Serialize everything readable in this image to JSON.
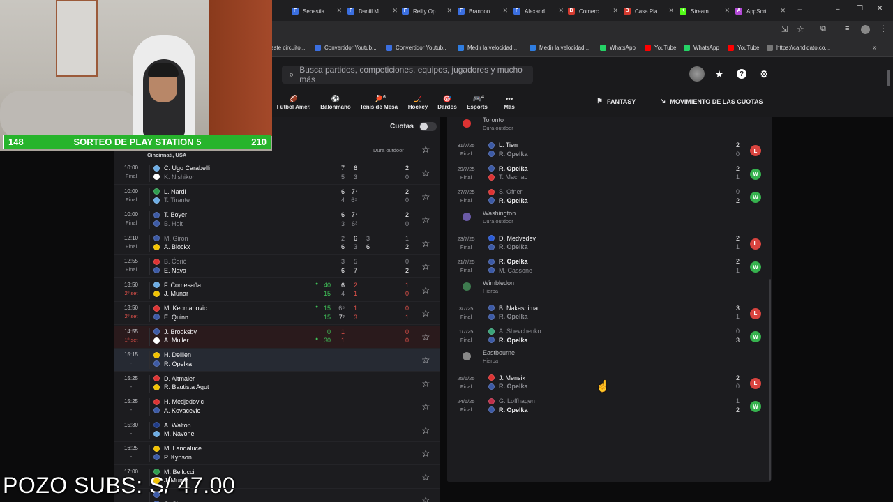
{
  "browser": {
    "tabs": [
      {
        "label": "este circuito",
        "fav": "",
        "color": "#555"
      },
      {
        "label": "Sebastia",
        "fav": "F",
        "color": "#3b6fe0"
      },
      {
        "label": "Daniil M",
        "fav": "F",
        "color": "#3b6fe0"
      },
      {
        "label": "Reilly Op",
        "fav": "F",
        "color": "#3b6fe0"
      },
      {
        "label": "Brandon",
        "fav": "F",
        "color": "#3b6fe0"
      },
      {
        "label": "Alexand",
        "fav": "F",
        "color": "#3b6fe0"
      },
      {
        "label": "Comerc",
        "fav": "B",
        "color": "#d43a2f"
      },
      {
        "label": "Casa Pla",
        "fav": "B",
        "color": "#d43a2f"
      },
      {
        "label": "Stream",
        "fav": "K",
        "color": "#53fc18"
      },
      {
        "label": "AppSort",
        "fav": "A",
        "color": "#b44ad8"
      }
    ],
    "bookmarks": [
      {
        "label": "este circuito...",
        "color": "#888"
      },
      {
        "label": "Convertidor Youtub...",
        "color": "#3b6fe0"
      },
      {
        "label": "Convertidor Youtub...",
        "color": "#3b6fe0"
      },
      {
        "label": "Medir la velocidad...",
        "color": "#2f7de1"
      },
      {
        "label": "Medir la velocidad...",
        "color": "#2f7de1"
      },
      {
        "label": "WhatsApp",
        "color": "#25d366"
      },
      {
        "label": "YouTube",
        "color": "#ff0000"
      },
      {
        "label": "WhatsApp",
        "color": "#25d366"
      },
      {
        "label": "YouTube",
        "color": "#ff0000"
      },
      {
        "label": "https://candidato.co...",
        "color": "#777"
      }
    ]
  },
  "header": {
    "search_placeholder": "Busca partidos, competiciones, equipos, jugadores y mucho más",
    "sports": [
      {
        "label": "Fútbol Amer.",
        "icon": "football-icon",
        "glyph": "🏈",
        "count": ""
      },
      {
        "label": "Balonmano",
        "icon": "handball-icon",
        "glyph": "⚽",
        "count": ""
      },
      {
        "label": "Tenis de Mesa",
        "icon": "table-tennis-icon",
        "glyph": "🏓",
        "count": "6"
      },
      {
        "label": "Hockey",
        "icon": "hockey-icon",
        "glyph": "🏒",
        "count": ""
      },
      {
        "label": "Dardos",
        "icon": "darts-icon",
        "glyph": "🎯",
        "count": ""
      },
      {
        "label": "Esports",
        "icon": "esports-icon",
        "glyph": "🎮",
        "count": "4"
      },
      {
        "label": "Más",
        "icon": "more-icon",
        "glyph": "•••",
        "count": ""
      }
    ],
    "fantasy": "FANTASY",
    "odds_movement": "MOVIMIENTO DE LAS CUOTAS"
  },
  "left": {
    "odds_label": "Cuotas",
    "tournament_place": "Cincinnati, USA",
    "surface": "Dura outdoor",
    "matches": [
      {
        "time": "10:00",
        "status": "Final",
        "live": false,
        "p1": {
          "name": "C. Ugo Carabelli",
          "flag": "#6cace4",
          "win": true
        },
        "p2": {
          "name": "K. Nishikori",
          "flag": "#ffffff",
          "win": false
        },
        "s1": [
          "7",
          "6"
        ],
        "s2": [
          "5",
          "3"
        ],
        "sets": [
          "2",
          "0"
        ],
        "pts": [
          "",
          ""
        ]
      },
      {
        "time": "10:00",
        "status": "Final",
        "live": false,
        "p1": {
          "name": "L. Nardi",
          "flag": "#2e9e4f",
          "win": true
        },
        "p2": {
          "name": "T. Tirante",
          "flag": "#6cace4",
          "win": false
        },
        "s1": [
          "6",
          "7⁷"
        ],
        "s2": [
          "4",
          "6⁵"
        ],
        "sets": [
          "2",
          "0"
        ],
        "pts": [
          "",
          ""
        ]
      },
      {
        "time": "10:00",
        "status": "Final",
        "live": false,
        "p1": {
          "name": "T. Boyer",
          "flag": "#3c5aa6",
          "win": true
        },
        "p2": {
          "name": "B. Holt",
          "flag": "#3c5aa6",
          "win": false
        },
        "s1": [
          "6",
          "7⁷"
        ],
        "s2": [
          "3",
          "6³"
        ],
        "sets": [
          "2",
          "0"
        ],
        "pts": [
          "",
          ""
        ]
      },
      {
        "time": "12:10",
        "status": "Final",
        "live": false,
        "p1": {
          "name": "M. Giron",
          "flag": "#3c5aa6",
          "win": false
        },
        "p2": {
          "name": "A. Blockx",
          "flag": "#f2c200",
          "win": true
        },
        "s1": [
          "2",
          "6",
          "3"
        ],
        "s2": [
          "6",
          "3",
          "6"
        ],
        "sets": [
          "1",
          "2"
        ],
        "pts": [
          "",
          ""
        ]
      },
      {
        "time": "12:55",
        "status": "Final",
        "live": false,
        "p1": {
          "name": "B. Ćorić",
          "flag": "#d33",
          "win": false
        },
        "p2": {
          "name": "E. Nava",
          "flag": "#3c5aa6",
          "win": true
        },
        "s1": [
          "3",
          "5"
        ],
        "s2": [
          "6",
          "7"
        ],
        "sets": [
          "0",
          "2"
        ],
        "pts": [
          "",
          ""
        ]
      },
      {
        "time": "13:50",
        "status": "2º set",
        "live": true,
        "p1": {
          "name": "F. Comesaña",
          "flag": "#6cace4",
          "win": true
        },
        "p2": {
          "name": "J. Munar",
          "flag": "#f2c200",
          "win": true
        },
        "s1": [
          "6",
          "2"
        ],
        "s2": [
          "4",
          "1"
        ],
        "sets": [
          "1",
          "0"
        ],
        "pts": [
          "40",
          "15"
        ],
        "serve": 1
      },
      {
        "time": "13:50",
        "status": "2º set",
        "live": true,
        "p1": {
          "name": "M. Kecmanovic",
          "flag": "#d33",
          "win": true
        },
        "p2": {
          "name": "E. Quinn",
          "flag": "#3c5aa6",
          "win": true
        },
        "s1": [
          "6⁵",
          "1"
        ],
        "s2": [
          "7⁷",
          "3"
        ],
        "sets": [
          "0",
          "1"
        ],
        "pts": [
          "15",
          "15"
        ],
        "serve": 1
      },
      {
        "time": "14:55",
        "status": "1º set",
        "live": true,
        "p1": {
          "name": "J. Brooksby",
          "flag": "#3c5aa6",
          "win": true
        },
        "p2": {
          "name": "A. Muller",
          "flag": "#ffffff",
          "win": true
        },
        "s1": [
          "1"
        ],
        "s2": [
          "1"
        ],
        "sets": [
          "0",
          "0"
        ],
        "pts": [
          "0",
          "30"
        ],
        "serve": 2
      },
      {
        "time": "15:15",
        "status": "-",
        "live": false,
        "p1": {
          "name": "H. Dellien",
          "flag": "#f2c200",
          "win": true
        },
        "p2": {
          "name": "R. Opelka",
          "flag": "#3c5aa6",
          "win": true
        },
        "s1": [],
        "s2": [],
        "sets": [
          "",
          ""
        ],
        "pts": [
          "",
          ""
        ]
      },
      {
        "time": "15:25",
        "status": "-",
        "live": false,
        "p1": {
          "name": "D. Altmaier",
          "flag": "#d33",
          "win": true
        },
        "p2": {
          "name": "R. Bautista Agut",
          "flag": "#f2c200",
          "win": true
        },
        "s1": [],
        "s2": [],
        "sets": [
          "",
          ""
        ],
        "pts": [
          "",
          ""
        ]
      },
      {
        "time": "15:25",
        "status": "-",
        "live": false,
        "p1": {
          "name": "H. Medjedovic",
          "flag": "#d33",
          "win": true
        },
        "p2": {
          "name": "A. Kovacevic",
          "flag": "#3c5aa6",
          "win": true
        },
        "s1": [],
        "s2": [],
        "sets": [
          "",
          ""
        ],
        "pts": [
          "",
          ""
        ]
      },
      {
        "time": "15:30",
        "status": "-",
        "live": false,
        "p1": {
          "name": "A. Walton",
          "flag": "#1f3c8a",
          "win": true
        },
        "p2": {
          "name": "M. Navone",
          "flag": "#6cace4",
          "win": true
        },
        "s1": [],
        "s2": [],
        "sets": [
          "",
          ""
        ],
        "pts": [
          "",
          ""
        ]
      },
      {
        "time": "16:25",
        "status": "-",
        "live": false,
        "p1": {
          "name": "M. Landaluce",
          "flag": "#f2c200",
          "win": true
        },
        "p2": {
          "name": "P. Kypson",
          "flag": "#3c5aa6",
          "win": true
        },
        "s1": [],
        "s2": [],
        "sets": [
          "",
          ""
        ],
        "pts": [
          "",
          ""
        ]
      },
      {
        "time": "17:00",
        "status": "-",
        "live": false,
        "p1": {
          "name": "M. Bellucci",
          "flag": "#2e9e4f",
          "win": true
        },
        "p2": {
          "name": "J. Munar",
          "flag": "#f2c200",
          "win": true
        },
        "s1": [],
        "s2": [],
        "sets": [
          "",
          ""
        ],
        "pts": [
          "",
          ""
        ]
      },
      {
        "time": "",
        "status": "-",
        "live": false,
        "p1": {
          "name": "",
          "flag": "#3c5aa6",
          "win": true
        },
        "p2": {
          "name": "C. Ciner",
          "flag": "#3c5aa6",
          "win": true
        },
        "s1": [],
        "s2": [],
        "sets": [
          "",
          ""
        ],
        "pts": [
          "",
          ""
        ]
      }
    ]
  },
  "right": {
    "groups": [
      {
        "name": "Toronto",
        "surface": "Dura outdoor",
        "color": "#d33",
        "matches": [
          {
            "date": "31/7/25",
            "status": "Final",
            "p1": {
              "name": "L. Tien",
              "flag": "#3c5aa6",
              "win": true
            },
            "p2": {
              "name": "R. Opelka",
              "flag": "#3c5aa6",
              "win": false
            },
            "sets": [
              "2",
              "0"
            ],
            "result": "L"
          },
          {
            "date": "29/7/25",
            "status": "Final",
            "p1": {
              "name": "R. Opelka",
              "flag": "#3c5aa6",
              "win": true
            },
            "p2": {
              "name": "T. Machac",
              "flag": "#d33",
              "win": false
            },
            "sets": [
              "2",
              "1"
            ],
            "result": "W"
          },
          {
            "date": "27/7/25",
            "status": "Final",
            "p1": {
              "name": "S. Ofner",
              "flag": "#d33",
              "win": false
            },
            "p2": {
              "name": "R. Opelka",
              "flag": "#3c5aa6",
              "win": true
            },
            "sets": [
              "0",
              "2"
            ],
            "result": "W"
          }
        ]
      },
      {
        "name": "Washington",
        "surface": "Dura outdoor",
        "color": "#6a5aa6",
        "matches": [
          {
            "date": "23/7/25",
            "status": "Final",
            "p1": {
              "name": "D. Medvedev",
              "flag": "#2a5bd7",
              "win": true
            },
            "p2": {
              "name": "R. Opelka",
              "flag": "#3c5aa6",
              "win": false
            },
            "sets": [
              "2",
              "1"
            ],
            "result": "L"
          },
          {
            "date": "21/7/25",
            "status": "Final",
            "p1": {
              "name": "R. Opelka",
              "flag": "#3c5aa6",
              "win": true
            },
            "p2": {
              "name": "M. Cassone",
              "flag": "#3c5aa6",
              "win": false
            },
            "sets": [
              "2",
              "1"
            ],
            "result": "W"
          }
        ]
      },
      {
        "name": "Wimbledon",
        "surface": "Hierba",
        "color": "#3e7b4f",
        "matches": [
          {
            "date": "3/7/25",
            "status": "Final",
            "p1": {
              "name": "B. Nakashima",
              "flag": "#3c5aa6",
              "win": true
            },
            "p2": {
              "name": "R. Opelka",
              "flag": "#3c5aa6",
              "win": false
            },
            "sets": [
              "3",
              "1"
            ],
            "result": "L"
          },
          {
            "date": "1/7/25",
            "status": "Final",
            "p1": {
              "name": "A. Shevchenko",
              "flag": "#3aa57a",
              "win": false
            },
            "p2": {
              "name": "R. Opelka",
              "flag": "#3c5aa6",
              "win": true
            },
            "sets": [
              "0",
              "3"
            ],
            "result": "W"
          }
        ]
      },
      {
        "name": "Eastbourne",
        "surface": "Hierba",
        "color": "#888",
        "matches": [
          {
            "date": "25/6/25",
            "status": "Final",
            "p1": {
              "name": "J. Mensik",
              "flag": "#d33",
              "win": true
            },
            "p2": {
              "name": "R. Opelka",
              "flag": "#3c5aa6",
              "win": false
            },
            "sets": [
              "2",
              "0"
            ],
            "result": "L"
          },
          {
            "date": "24/6/25",
            "status": "Final",
            "p1": {
              "name": "G. Loffhagen",
              "flag": "#c0304a",
              "win": false
            },
            "p2": {
              "name": "R. Opelka",
              "flag": "#3c5aa6",
              "win": true
            },
            "sets": [
              "1",
              "2"
            ],
            "result": "W"
          }
        ]
      }
    ]
  },
  "overlay": {
    "raffle_left": "148",
    "raffle_title": "SORTEO DE PLAY STATION 5",
    "raffle_right": "210",
    "pozo": "POZO SUBS: S/ 47.00"
  }
}
